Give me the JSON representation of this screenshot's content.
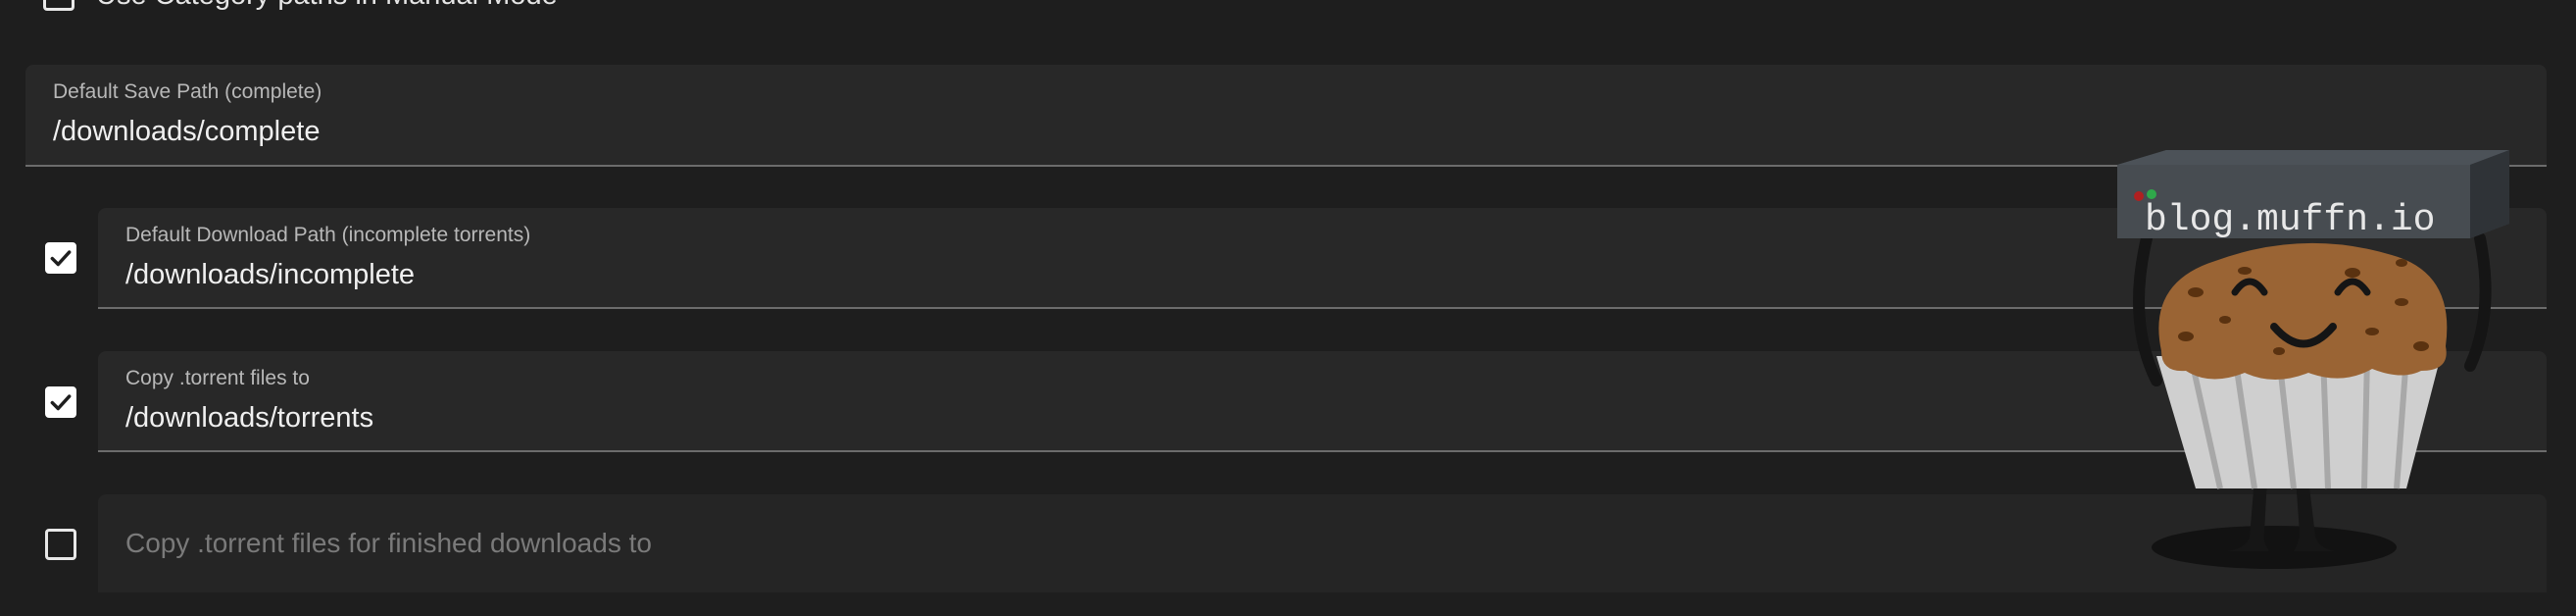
{
  "top_option": {
    "label": "Use Category paths in Manual Mode",
    "checked": false
  },
  "default_save_path": {
    "label": "Default Save Path (complete)",
    "value": "/downloads/complete"
  },
  "download_path": {
    "checked": true,
    "label": "Default Download Path (incomplete torrents)",
    "value": "/downloads/incomplete"
  },
  "copy_torrent": {
    "checked": true,
    "label": "Copy .torrent files to",
    "value": "/downloads/torrents"
  },
  "copy_finished": {
    "checked": false,
    "placeholder": "Copy .torrent files for finished downloads to"
  },
  "watermark": {
    "text": "blog.muffn.io",
    "icon": "muffin-mascot-icon"
  },
  "colors": {
    "background": "#1e1e1e",
    "field": "#282828",
    "checkbox": "#ffffff"
  }
}
